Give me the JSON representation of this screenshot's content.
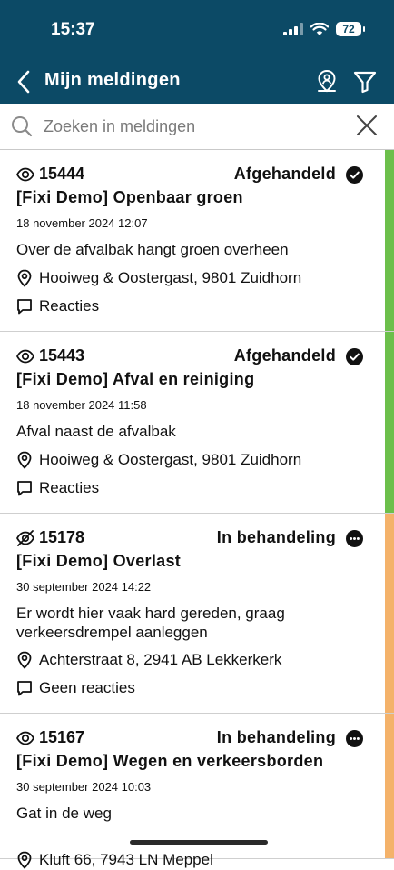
{
  "status_bar": {
    "time": "15:37",
    "battery": "72"
  },
  "nav": {
    "title": "Mijn meldingen"
  },
  "search": {
    "placeholder": "Zoeken in meldingen",
    "value": ""
  },
  "colors": {
    "header": "#0c4a66",
    "done": "#6cbf4b",
    "in_progress": "#f4b26a"
  },
  "reports": [
    {
      "id": "15444",
      "status": "Afgehandeld",
      "status_type": "done",
      "watched": true,
      "title": "[Fixi Demo] Openbaar groen",
      "date": "18 november 2024 12:07",
      "description": "Over de afvalbak hangt groen overheen",
      "location": "Hooiweg & Oostergast, 9801 Zuidhorn",
      "comments": "Reacties"
    },
    {
      "id": "15443",
      "status": "Afgehandeld",
      "status_type": "done",
      "watched": true,
      "title": "[Fixi Demo] Afval en reiniging",
      "date": "18 november 2024 11:58",
      "description": "Afval naast de afvalbak",
      "location": "Hooiweg & Oostergast, 9801 Zuidhorn",
      "comments": "Reacties"
    },
    {
      "id": "15178",
      "status": "In behandeling",
      "status_type": "in_progress",
      "watched": false,
      "title": "[Fixi Demo] Overlast",
      "date": "30 september 2024 14:22",
      "description": "Er wordt hier vaak hard gereden, graag verkeersdrempel aanleggen",
      "location": "Achterstraat 8, 2941 AB Lekkerkerk",
      "comments": "Geen reacties"
    },
    {
      "id": "15167",
      "status": "In behandeling",
      "status_type": "in_progress",
      "watched": true,
      "title": "[Fixi Demo] Wegen en verkeersborden",
      "date": "30 september 2024 10:03",
      "description": "Gat in de weg",
      "location": "Kluft 66, 7943 LN Meppel",
      "comments": ""
    }
  ]
}
